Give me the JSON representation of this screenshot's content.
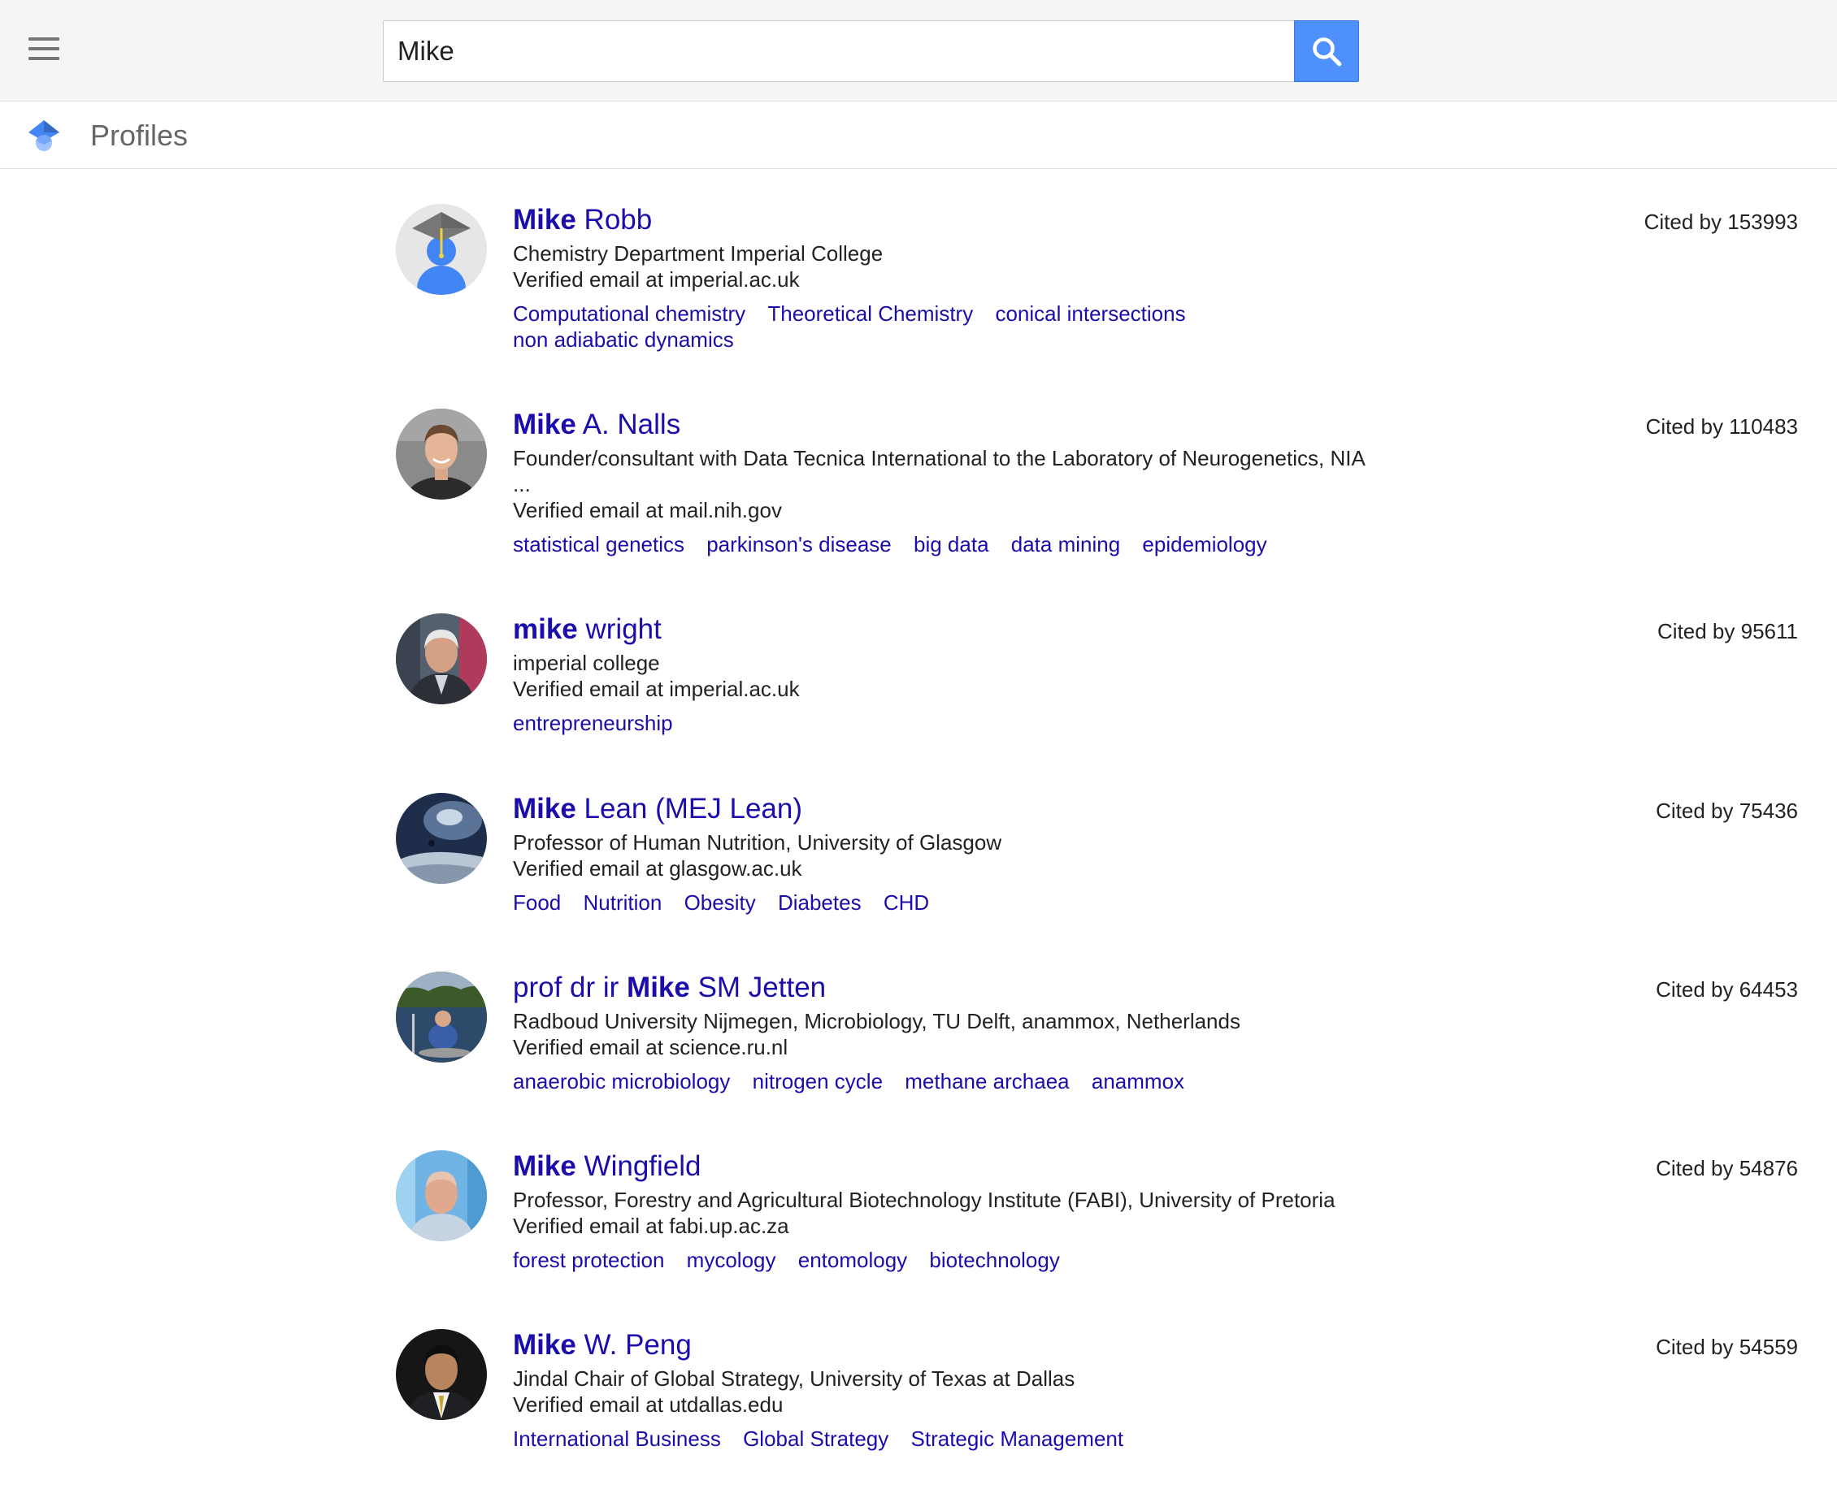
{
  "search": {
    "query": "Mike"
  },
  "header": {
    "title": "Profiles"
  },
  "profiles": [
    {
      "name_bold": "Mike",
      "name_rest": " Robb",
      "affiliation": "Chemistry Department Imperial College",
      "email": "Verified email at imperial.ac.uk",
      "cited": "Cited by 153993",
      "interests": [
        "Computational chemistry",
        "Theoretical Chemistry",
        "conical intersections",
        "non adiabatic dynamics"
      ]
    },
    {
      "name_bold": "Mike",
      "name_rest": " A. Nalls",
      "affiliation": "Founder/consultant with Data Tecnica International to the Laboratory of Neurogenetics, NIA ...",
      "email": "Verified email at mail.nih.gov",
      "cited": "Cited by 110483",
      "interests": [
        "statistical genetics",
        "parkinson's disease",
        "big data",
        "data mining",
        "epidemiology"
      ]
    },
    {
      "name_bold": "mike",
      "name_rest": " wright",
      "affiliation": "imperial college",
      "email": "Verified email at imperial.ac.uk",
      "cited": "Cited by 95611",
      "interests": [
        "entrepreneurship"
      ]
    },
    {
      "name_bold": "Mike",
      "name_rest": " Lean (MEJ Lean)",
      "affiliation": "Professor of Human Nutrition, University of Glasgow",
      "email": "Verified email at glasgow.ac.uk",
      "cited": "Cited by 75436",
      "interests": [
        "Food",
        "Nutrition",
        "Obesity",
        "Diabetes",
        "CHD"
      ]
    },
    {
      "name_pre": "prof dr ir ",
      "name_bold": "Mike",
      "name_rest": " SM Jetten",
      "affiliation": "Radboud University Nijmegen, Microbiology, TU Delft, anammox, Netherlands",
      "email": "Verified email at science.ru.nl",
      "cited": "Cited by 64453",
      "interests": [
        "anaerobic microbiology",
        "nitrogen cycle",
        "methane archaea",
        "anammox"
      ]
    },
    {
      "name_bold": "Mike",
      "name_rest": " Wingfield",
      "affiliation": "Professor, Forestry and Agricultural Biotechnology Institute (FABI), University of Pretoria",
      "email": "Verified email at fabi.up.ac.za",
      "cited": "Cited by 54876",
      "interests": [
        "forest protection",
        "mycology",
        "entomology",
        "biotechnology"
      ]
    },
    {
      "name_bold": "Mike",
      "name_rest": " W. Peng",
      "affiliation": "Jindal Chair of Global Strategy, University of Texas at Dallas",
      "email": "Verified email at utdallas.edu",
      "cited": "Cited by 54559",
      "interests": [
        "International Business",
        "Global Strategy",
        "Strategic Management"
      ]
    }
  ]
}
